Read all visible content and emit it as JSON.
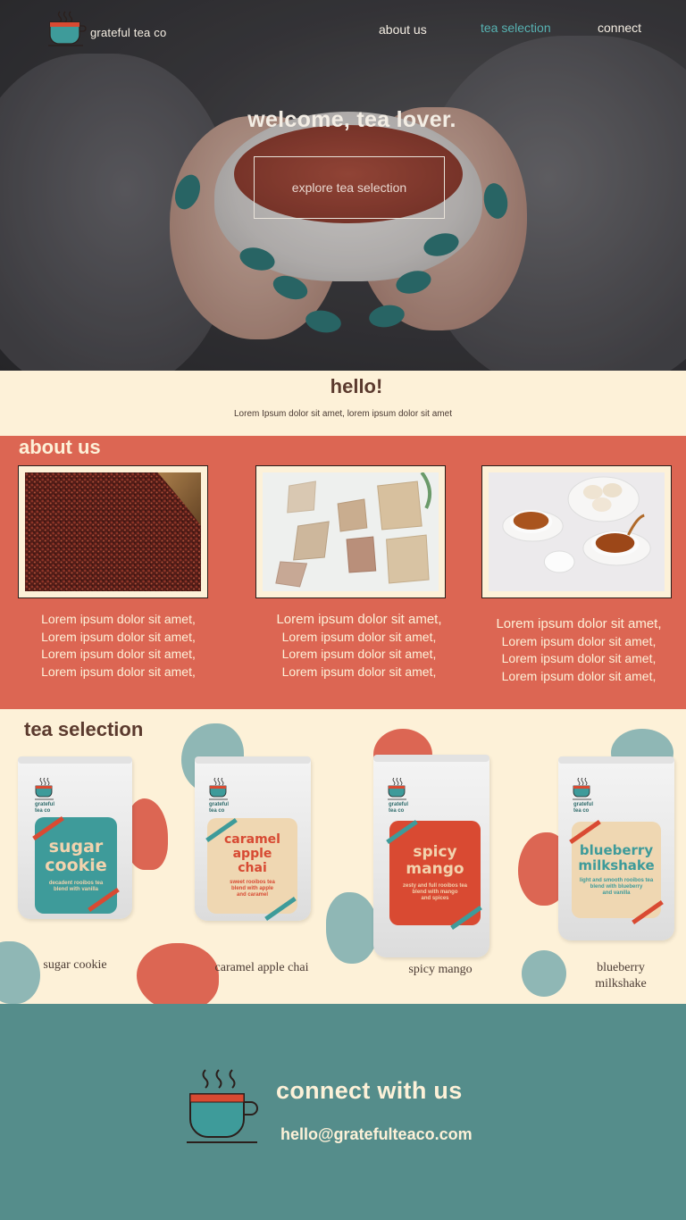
{
  "header": {
    "brand": "grateful tea co",
    "nav": [
      {
        "label": "about us"
      },
      {
        "label": "tea selection",
        "active": true
      },
      {
        "label": "connect"
      }
    ]
  },
  "hero": {
    "title": "welcome, tea lover.",
    "button_label": "explore tea selection"
  },
  "hello": {
    "heading": "hello!",
    "text": "Lorem Ipsum dolor sit amet, lorem ipsum dolor sit amet"
  },
  "about": {
    "heading": "about us",
    "columns": [
      {
        "image": "loose-leaf-tea-photo",
        "lines": [
          "Lorem ipsum dolor sit amet,",
          "Lorem ipsum dolor sit amet,",
          "Lorem ipsum dolor sit amet,",
          "Lorem ipsum dolor sit amet,"
        ]
      },
      {
        "image": "tea-bags-photo",
        "lines": [
          "Lorem ipsum dolor sit amet,",
          "Lorem ipsum dolor sit amet,",
          "Lorem ipsum dolor sit amet,",
          "Lorem ipsum dolor sit amet,"
        ]
      },
      {
        "image": "tea-cups-macarons-photo",
        "lines": [
          "Lorem ipsum dolor sit amet,",
          "Lorem ipsum dolor sit amet,",
          "Lorem ipsum dolor sit amet,",
          "Lorem ipsum dolor sit amet,"
        ]
      }
    ]
  },
  "tea_selection": {
    "heading": "tea selection",
    "products": [
      {
        "caption": "sugar cookie",
        "bag_name_1": "sugar",
        "bag_name_2": "cookie",
        "bag_desc_1": "decadent rooibos tea",
        "bag_desc_2": "blend with vanilla",
        "label_color": "#3e9b9a",
        "text_color": "#f2d3ae"
      },
      {
        "caption": "caramel apple chai",
        "bag_name_1": "caramel",
        "bag_name_2": "apple",
        "bag_name_3": "chai",
        "bag_desc_1": "sweet rooibos tea",
        "bag_desc_2": "blend with apple",
        "bag_desc_3": "and caramel",
        "label_color": "#efd7b2",
        "text_color": "#d74a33"
      },
      {
        "caption": "spicy mango",
        "bag_name_1": "spicy",
        "bag_name_2": "mango",
        "bag_desc_1": "zesty and full rooibos tea",
        "bag_desc_2": "blend with mango",
        "bag_desc_3": "and spices",
        "label_color": "#d94a32",
        "text_color": "#f2d3ae"
      },
      {
        "caption_1": "blueberry",
        "caption_2": "milkshake",
        "bag_name_1": "blueberry",
        "bag_name_2": "milkshake",
        "bag_desc_1": "light and smooth rooibos tea",
        "bag_desc_2": "blend with blueberry",
        "bag_desc_3": "and vanilla",
        "label_color": "#efd7b2",
        "text_color": "#3e9b9a"
      }
    ],
    "mini_brand_1": "grateful",
    "mini_brand_2": "tea co"
  },
  "connect": {
    "heading": "connect with us",
    "email": "hello@gratefulteaco.com"
  },
  "colors": {
    "cream": "#fdf1d8",
    "coral": "#dc6653",
    "teal": "#558d8b",
    "brown": "#5b3a2e",
    "nav_active": "#57b3b2"
  }
}
